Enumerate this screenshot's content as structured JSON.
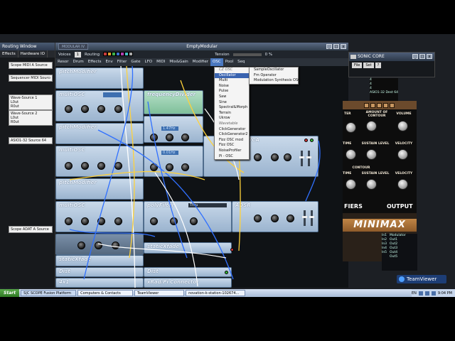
{
  "routing_window": {
    "title": "Routing Window",
    "tabs": [
      "Effects",
      "Hardware IO"
    ],
    "sources": [
      {
        "lines": [
          "Scope MIDI A Source"
        ]
      },
      {
        "lines": [
          "Sequencer MIDI Source"
        ]
      },
      {
        "lines": [
          "Wave-Source 1",
          "L0ut",
          "R0ut"
        ]
      },
      {
        "lines": [
          "Wave-Source 2",
          "L0ut",
          "R0ut"
        ]
      },
      {
        "lines": [
          "ASIO1-32 Source 64"
        ]
      },
      {
        "lines": [
          "Scope ADAT A Source"
        ]
      }
    ]
  },
  "modular_window": {
    "logo": "MODULAR IV",
    "title": "EmptyModular",
    "voices_label": "Voices",
    "voices_value": "1",
    "routing_label": "Routing",
    "tension_label": "Tension",
    "tension_value": "0 %",
    "window_buttons": [
      "_",
      "□",
      "x"
    ],
    "menu": [
      "Resor",
      "Drum",
      "Effects",
      "Env",
      "Filter",
      "Gate",
      "LFO",
      "MIDI",
      "Mix&Gain",
      "Modifier",
      "OSC",
      "Pool",
      "Seq"
    ],
    "active_menu": "OSC",
    "routing_colors": [
      "#c83b3b",
      "#e0a030",
      "#3fb04a",
      "#3b6fd0",
      "#b040b0",
      "#40c0c0",
      "#aaaaaa"
    ]
  },
  "modules": [
    {
      "name": "pitchModifier",
      "label": "pitchModifier"
    },
    {
      "name": "multiOSC-1",
      "label": "multiOSC"
    },
    {
      "name": "frequencyDivider",
      "label": "frequencyDivider"
    },
    {
      "name": "pitchModifier-2",
      "label": "pitchModifier"
    },
    {
      "name": "multiOSC-2",
      "label": "multiOSC"
    },
    {
      "name": "VCA",
      "label": "VCA"
    },
    {
      "name": "pitchModifier-3",
      "label": "pitchModifier"
    },
    {
      "name": "multiOSC-3",
      "label": "multiOSC"
    },
    {
      "name": "polyFilter",
      "label": "polyFilter"
    },
    {
      "name": "ADSR",
      "label": "ADSR"
    },
    {
      "name": "staticXfade",
      "label": "staticXfade"
    },
    {
      "name": "staticXfade-2",
      "label": "staticXfade"
    },
    {
      "name": "Dist",
      "label": "Dist"
    },
    {
      "name": "4x1",
      "label": "4x1"
    },
    {
      "name": "xRad-P-Connector",
      "label": "xRad/Pi Connector"
    }
  ],
  "module_values": {
    "freq": "1.47Hz",
    "freq2": "0.01Hz",
    "filter_mode": "Thru"
  },
  "osc_menu": {
    "header": "CZ OSC",
    "items": [
      "Oscillator",
      "Multi",
      "Noise",
      "Pulse",
      "Saw",
      "Sine",
      "Spectral&Morph",
      "Terrain",
      "Ukrow",
      "Wavetable",
      "ClickGenerator",
      "ClickGenerator2",
      "Fizz OSC mod",
      "Fizz OSC",
      "NoiseProfiler",
      "Pi - OSC"
    ],
    "selected": "Oscillator"
  },
  "osc_submenu": {
    "items": [
      "SampleOscillator",
      "Fm Operator",
      "Modulation Synthesis OSC"
    ]
  },
  "sonic_core": {
    "title": "SONIC CORE",
    "icon": "sc-logo-icon",
    "buttons": [
      "File",
      "Set",
      "?"
    ],
    "window_buttons": [
      "_",
      "□",
      "x"
    ]
  },
  "side_list": [
    "4",
    "4",
    "4",
    "ASIO1-32 Dest 64"
  ],
  "minimax": {
    "labels": [
      "AMOUNT OF CONTOUR",
      "VOLUME",
      "SUSTAIN LEVEL",
      "VELOCITY",
      "CONTOUR",
      "SUSTAIN LEVEL",
      "VELOCITY"
    ],
    "section_left": "FIERS",
    "section_right": "OUTPUT",
    "logo": "MINIMAX",
    "left_labels": [
      "TER",
      "TIME",
      "TIME"
    ]
  },
  "mod_list": [
    "Modulator",
    "In1",
    "In2",
    "In3",
    "In4",
    "In5"
  ],
  "mod_outs": [
    "Out1",
    "Out2",
    "Out3",
    "Out4",
    "Out5"
  ],
  "teamviewer_badge": "TeamViewer",
  "taskbar": {
    "start": "Start",
    "tasks": [
      "S|C SCOPE Fusion Platform",
      "Computers & Contacts",
      "TeamViewer",
      "novation-k-station-102674..."
    ],
    "lang": "EN",
    "time": "9:04 PM"
  }
}
